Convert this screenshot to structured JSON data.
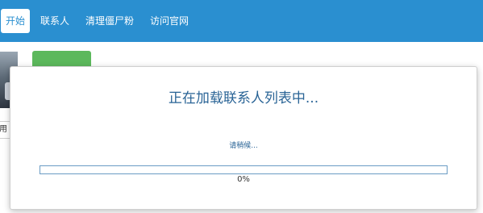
{
  "nav": {
    "tabs": [
      {
        "label": "开始",
        "active": true
      },
      {
        "label": "联系人",
        "active": false
      },
      {
        "label": "清理僵尸粉",
        "active": false
      },
      {
        "label": "访问官网",
        "active": false
      }
    ],
    "bar_color": "#2a8fd0"
  },
  "background": {
    "partial_label": "用"
  },
  "modal": {
    "title": "正在加载联系人列表中...",
    "subtitle": "请稍候...",
    "progress_percent": 0,
    "progress_text": "0%"
  }
}
